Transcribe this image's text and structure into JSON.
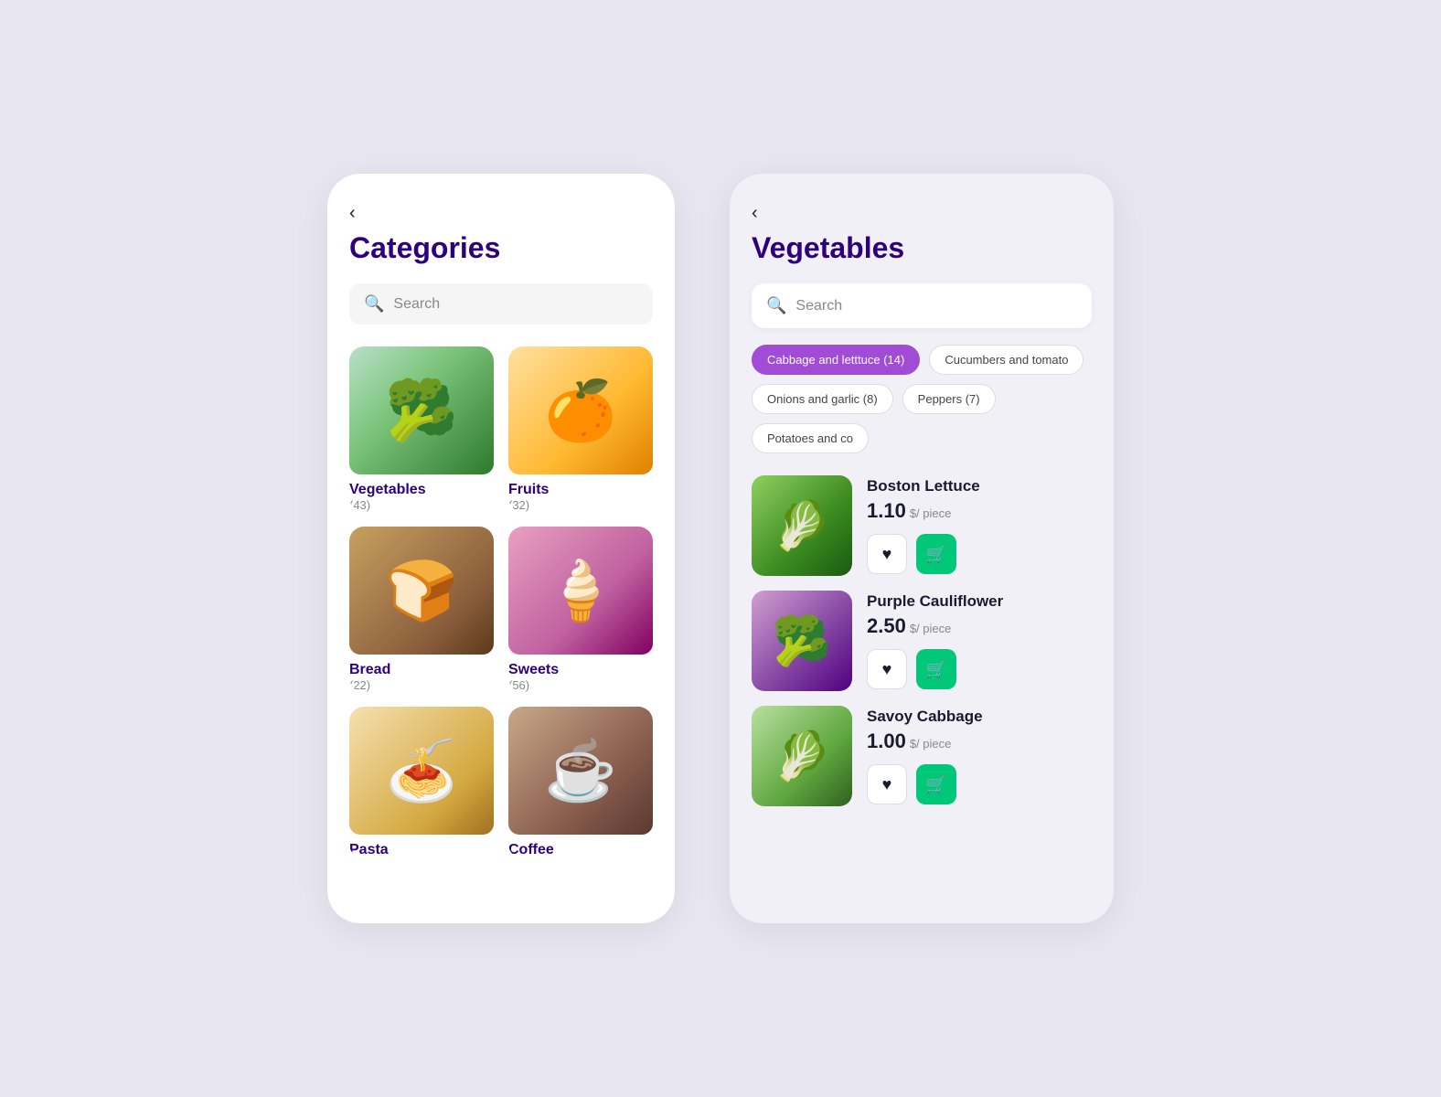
{
  "background": "#e8e6f0",
  "leftPhone": {
    "backLabel": "‹",
    "title": "Categories",
    "searchPlaceholder": "Search",
    "categories": [
      {
        "id": "vegetables",
        "name": "Vegetables",
        "count": "(43)",
        "imgClass": "img-vegetables"
      },
      {
        "id": "fruits",
        "name": "Fruits",
        "count": "(32)",
        "imgClass": "img-fruits"
      },
      {
        "id": "bread",
        "name": "Bread",
        "count": "(22)",
        "imgClass": "img-bread"
      },
      {
        "id": "sweets",
        "name": "Sweets",
        "count": "(56)",
        "imgClass": "img-sweets"
      },
      {
        "id": "pasta",
        "name": "Pasta",
        "count": "",
        "imgClass": "img-pasta"
      },
      {
        "id": "coffee",
        "name": "Coffee",
        "count": "",
        "imgClass": "img-coffee"
      }
    ]
  },
  "rightPhone": {
    "backLabel": "‹",
    "title": "Vegetables",
    "searchPlaceholder": "Search",
    "filters": [
      {
        "id": "cabbage",
        "label": "Cabbage and letttuce (14)",
        "active": true
      },
      {
        "id": "cucumbers",
        "label": "Cucumbers and tomato",
        "active": false
      },
      {
        "id": "onions",
        "label": "Onions and garlic (8)",
        "active": false
      },
      {
        "id": "peppers",
        "label": "Peppers (7)",
        "active": false
      },
      {
        "id": "potatoes",
        "label": "Potatoes and co",
        "active": false
      }
    ],
    "products": [
      {
        "id": "lettuce",
        "name": "Boston Lettuce",
        "price": "1.10",
        "unit": "$/ piece",
        "imgClass": "img-lettuce"
      },
      {
        "id": "cauliflower",
        "name": "Purple Cauliflower",
        "price": "2.50",
        "unit": "$/ piece",
        "imgClass": "img-cauliflower"
      },
      {
        "id": "cabbage",
        "name": "Savoy Cabbage",
        "price": "1.00",
        "unit": "$/ piece",
        "imgClass": "img-cabbage"
      }
    ]
  },
  "icons": {
    "search": "🔍",
    "heart": "♥",
    "cart": "🛒"
  }
}
